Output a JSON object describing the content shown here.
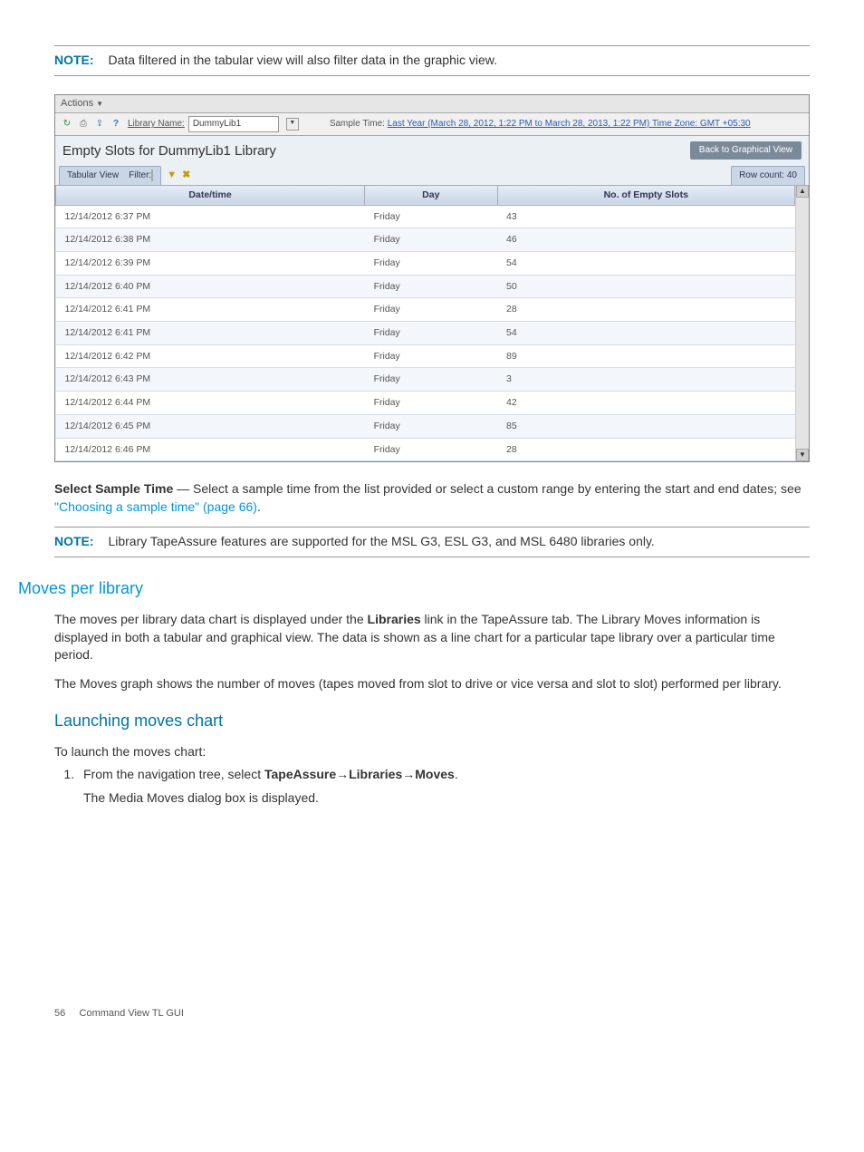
{
  "note1": {
    "label": "NOTE:",
    "text": "Data filtered in the tabular view will also filter data in the graphic view."
  },
  "screenshot": {
    "actions_label": "Actions",
    "library_name_label": "Library Name:",
    "library_name_value": "DummyLib1",
    "sample_time_label": "Sample Time:",
    "sample_time_link": "Last Year (March 28, 2012, 1:22 PM to March 28, 2013, 1:22 PM) Time Zone: GMT +05:30",
    "panel_title": "Empty Slots for DummyLib1  Library",
    "back_button": "Back to Graphical View",
    "tab_label": "Tabular View",
    "filter_label": "Filter:",
    "row_count": "Row count: 40",
    "columns": [
      "Date/time",
      "Day",
      "No. of Empty Slots"
    ],
    "rows": [
      {
        "dt": "12/14/2012 6:37 PM",
        "day": "Friday",
        "slots": "43"
      },
      {
        "dt": "12/14/2012 6:38 PM",
        "day": "Friday",
        "slots": "46"
      },
      {
        "dt": "12/14/2012 6:39 PM",
        "day": "Friday",
        "slots": "54"
      },
      {
        "dt": "12/14/2012 6:40 PM",
        "day": "Friday",
        "slots": "50"
      },
      {
        "dt": "12/14/2012 6:41 PM",
        "day": "Friday",
        "slots": "28"
      },
      {
        "dt": "12/14/2012 6:41 PM",
        "day": "Friday",
        "slots": "54"
      },
      {
        "dt": "12/14/2012 6:42 PM",
        "day": "Friday",
        "slots": "89"
      },
      {
        "dt": "12/14/2012 6:43 PM",
        "day": "Friday",
        "slots": "3"
      },
      {
        "dt": "12/14/2012 6:44 PM",
        "day": "Friday",
        "slots": "42"
      },
      {
        "dt": "12/14/2012 6:45 PM",
        "day": "Friday",
        "slots": "85"
      },
      {
        "dt": "12/14/2012 6:46 PM",
        "day": "Friday",
        "slots": "28"
      }
    ]
  },
  "sample_time_para": {
    "lead": "Select Sample Time",
    "text1": " — Select a sample time from the list provided or select a custom range by entering the start and end dates; see ",
    "link": "\"Choosing a sample time\" (page 66)",
    "text2": "."
  },
  "note2": {
    "label": "NOTE:",
    "text": "Library TapeAssure features are supported for the MSL G3, ESL G3, and MSL 6480 libraries only."
  },
  "moves": {
    "heading": "Moves per library",
    "p1a": "The moves per library data chart is displayed under the ",
    "p1b": "Libraries",
    "p1c": " link in the TapeAssure tab. The Library Moves information is displayed in both a tabular and graphical view. The data is shown as a line chart for a particular tape library over a particular time period.",
    "p2": "The Moves graph shows the number of moves (tapes moved from slot to drive or vice versa and slot to slot) performed per library."
  },
  "launch": {
    "heading": "Launching moves chart",
    "intro": "To launch the moves chart:",
    "step1a": "From the navigation tree, select ",
    "step1b": "TapeAssure",
    "step1c": "→",
    "step1d": "Libraries",
    "step1e": "→",
    "step1f": "Moves",
    "step1g": ".",
    "step1_sub": "The Media Moves dialog box is displayed."
  },
  "footer": {
    "page": "56",
    "title": "Command View TL GUI"
  }
}
